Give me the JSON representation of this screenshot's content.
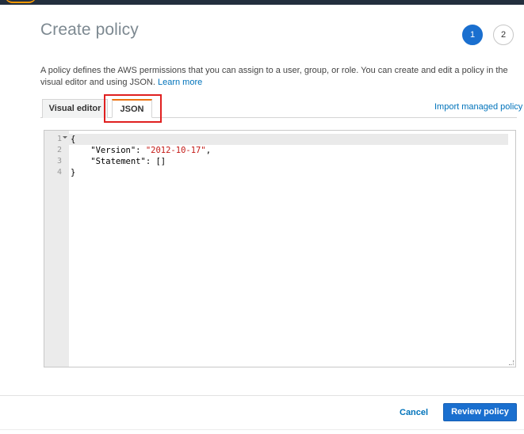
{
  "header": {
    "title": "Create policy"
  },
  "steps": [
    {
      "label": "1",
      "state": "active"
    },
    {
      "label": "2",
      "state": "inactive"
    }
  ],
  "description": {
    "text": "A policy defines the AWS permissions that you can assign to a user, group, or role. You can create and edit a policy in the visual editor and using JSON.",
    "link_label": "Learn more"
  },
  "tabs": [
    {
      "label": "Visual editor",
      "selected": false
    },
    {
      "label": "JSON",
      "selected": true
    }
  ],
  "import_link": "Import managed policy",
  "editor": {
    "line_numbers": [
      "1",
      "2",
      "3",
      "4"
    ],
    "lines": [
      {
        "text": "{"
      },
      {
        "key": "    \"Version\": ",
        "value": "\"2012-10-17\"",
        "suffix": ","
      },
      {
        "key": "    \"Statement\": ",
        "value": "[]"
      },
      {
        "text": "}"
      }
    ]
  },
  "footer": {
    "cancel_label": "Cancel",
    "review_label": "Review policy"
  },
  "colors": {
    "primary": "#1a6fcf",
    "link": "#0073bb",
    "highlight": "#e02020",
    "tab_accent": "#ec7211",
    "string_token": "#c41a16"
  }
}
